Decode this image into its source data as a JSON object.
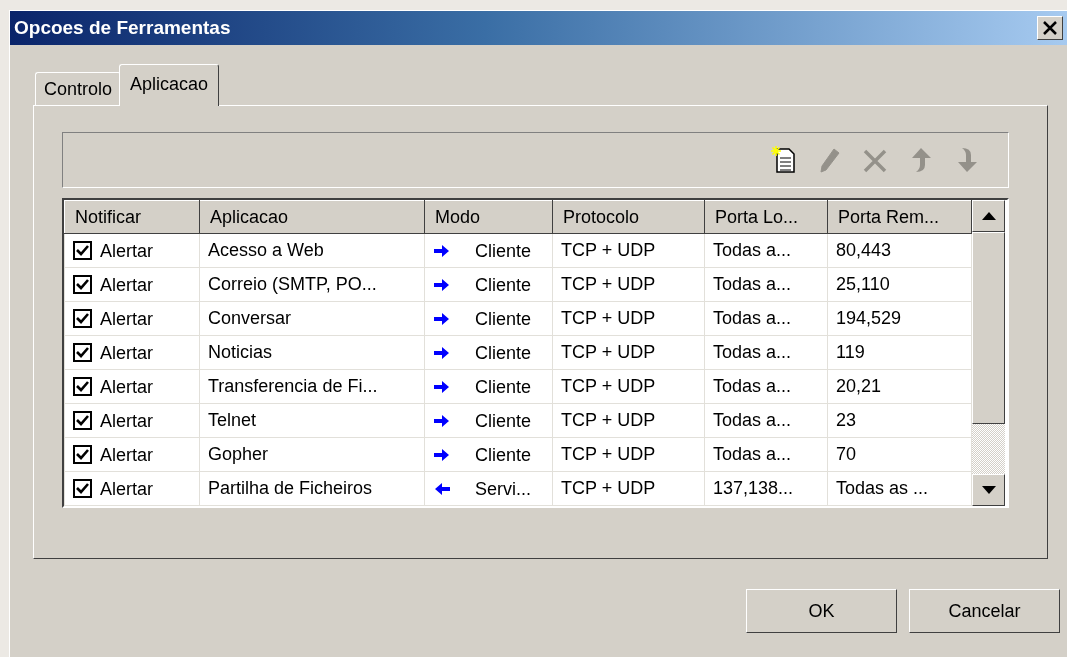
{
  "window": {
    "title": "Opcoes de Ferramentas"
  },
  "tabs": [
    {
      "label": "Controlo",
      "selected": false
    },
    {
      "label": "Aplicacao",
      "selected": true
    }
  ],
  "toolbar": [
    {
      "kind": "new",
      "disabled": false
    },
    {
      "kind": "edit",
      "disabled": true
    },
    {
      "kind": "delete",
      "disabled": true
    },
    {
      "kind": "up",
      "disabled": true
    },
    {
      "kind": "down",
      "disabled": true
    }
  ],
  "table": {
    "columns": [
      "Notificar",
      "Aplicacao",
      "Modo",
      "Protocolo",
      "Porta Lo...",
      "Porta Rem..."
    ],
    "rows": [
      {
        "checked": true,
        "notify": "Alertar",
        "application": "Acesso a Web",
        "incoming": false,
        "mode": "Cliente",
        "protocol": "TCP + UDP",
        "local_port": "Todas a...",
        "remote_port": "80,443"
      },
      {
        "checked": true,
        "notify": "Alertar",
        "application": "Correio (SMTP, PO...",
        "incoming": false,
        "mode": "Cliente",
        "protocol": "TCP + UDP",
        "local_port": "Todas a...",
        "remote_port": "25,110"
      },
      {
        "checked": true,
        "notify": "Alertar",
        "application": "Conversar",
        "incoming": false,
        "mode": "Cliente",
        "protocol": "TCP + UDP",
        "local_port": "Todas a...",
        "remote_port": "194,529"
      },
      {
        "checked": true,
        "notify": "Alertar",
        "application": "Noticias",
        "incoming": false,
        "mode": "Cliente",
        "protocol": "TCP + UDP",
        "local_port": "Todas a...",
        "remote_port": "119"
      },
      {
        "checked": true,
        "notify": "Alertar",
        "application": "Transferencia de Fi...",
        "incoming": false,
        "mode": "Cliente",
        "protocol": "TCP + UDP",
        "local_port": "Todas a...",
        "remote_port": "20,21"
      },
      {
        "checked": true,
        "notify": "Alertar",
        "application": "Telnet",
        "incoming": false,
        "mode": "Cliente",
        "protocol": "TCP + UDP",
        "local_port": "Todas a...",
        "remote_port": "23"
      },
      {
        "checked": true,
        "notify": "Alertar",
        "application": "Gopher",
        "incoming": false,
        "mode": "Cliente",
        "protocol": "TCP + UDP",
        "local_port": "Todas a...",
        "remote_port": "70"
      },
      {
        "checked": true,
        "notify": "Alertar",
        "application": "Partilha de Ficheiros",
        "incoming": true,
        "mode": "Servi...",
        "protocol": "TCP + UDP",
        "local_port": "137,138...",
        "remote_port": "Todas as ..."
      }
    ]
  },
  "buttons": [
    {
      "label": "OK"
    },
    {
      "label": "Cancelar"
    }
  ]
}
